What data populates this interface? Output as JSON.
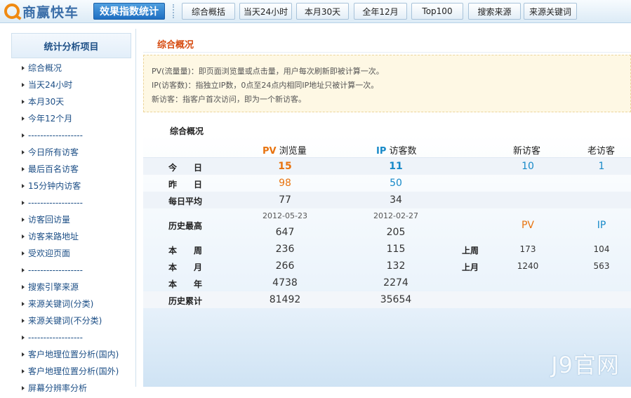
{
  "app": {
    "logo_text": "商赢快车",
    "brand_button": "效果指数统计"
  },
  "nav": [
    "综合概括",
    "当天24小时",
    "本月30天",
    "全年12月",
    "Top100",
    "搜索来源",
    "来源关键词"
  ],
  "sidebar": {
    "title": "统计分析项目",
    "items": [
      "综合概况",
      "当天24小时",
      "本月30天",
      "今年12个月",
      "------------------",
      "今日所有访客",
      "最后百名访客",
      "15分钟内访客",
      "------------------",
      "访客回访量",
      "访客来路地址",
      "受欢迎页面",
      "------------------",
      "搜索引擎来源",
      "来源关键词(分类)",
      "来源关键词(不分类)",
      "------------------",
      "客户地理位置分析(国内)",
      "客户地理位置分析(国外)",
      "屏幕分辨率分析"
    ]
  },
  "main": {
    "title": "综合概况",
    "info_lines": [
      "PV(流量量)：即页面浏览量或点击量，用户每次刷新即被计算一次。",
      "IP(访客数)：指独立IP数，0点至24点内相同IP地址只被计算一次。",
      "新访客：指客户首次访问，即为一个新访客。"
    ],
    "overview_label": "综合概况",
    "headers": {
      "pv_tag": "PV",
      "pv_text": " 浏览量",
      "ip_tag": "IP",
      "ip_text": " 访客数",
      "new_visitors": "新访客",
      "old_visitors": "老访客"
    },
    "rows": {
      "today": {
        "label": "今　　日",
        "pv": "15",
        "ip": "11",
        "new": "10",
        "old": "1"
      },
      "yesterday": {
        "label": "昨　　日",
        "pv": "98",
        "ip": "50"
      },
      "daily_avg": {
        "label": "每日平均",
        "pv": "77",
        "ip": "34"
      },
      "history_max": {
        "label": "历史最高",
        "pv_date": "2012-05-23",
        "pv": "647",
        "ip_date": "2012-02-27",
        "ip": "205",
        "cmp_pv": "PV",
        "cmp_ip": "IP"
      },
      "this_week": {
        "label": "本　　周",
        "pv": "236",
        "ip": "115",
        "cmp_label": "上周",
        "cmp_pv": "173",
        "cmp_ip": "104"
      },
      "this_month": {
        "label": "本　　月",
        "pv": "266",
        "ip": "132",
        "cmp_label": "上月",
        "cmp_pv": "1240",
        "cmp_ip": "563"
      },
      "this_year": {
        "label": "本　　年",
        "pv": "4738",
        "ip": "2274"
      },
      "history_total": {
        "label": "历史累计",
        "pv": "81492",
        "ip": "35654"
      }
    },
    "watermark": "J9官网",
    "colors": {
      "pv": "#e8730f",
      "ip": "#1789c8",
      "title": "#d64a0f"
    }
  }
}
